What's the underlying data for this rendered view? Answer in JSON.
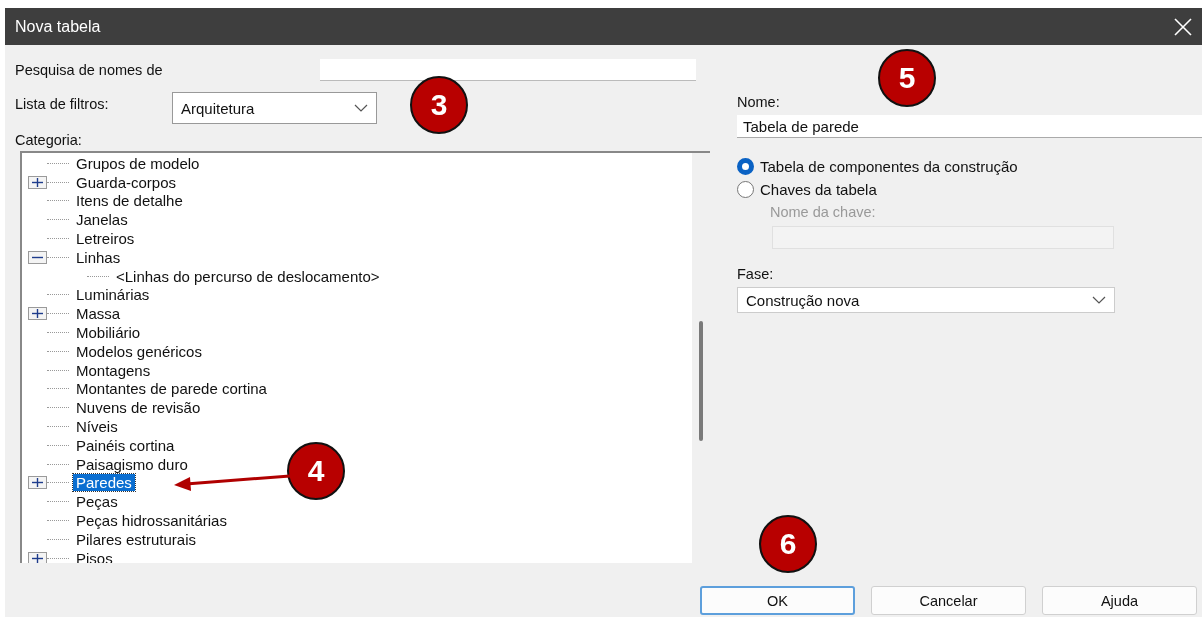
{
  "window": {
    "title": "Nova tabela"
  },
  "search": {
    "label": "Pesquisa de nomes de"
  },
  "filter": {
    "label": "Lista de filtros:",
    "value": "Arquitetura"
  },
  "category": {
    "label": "Categoria:",
    "items": [
      {
        "label": "Grupos de modelo",
        "selected": false
      },
      {
        "label": "Guarda-corpos",
        "selected": false,
        "expanded": false
      },
      {
        "label": "Itens de detalhe",
        "selected": false
      },
      {
        "label": "Janelas",
        "selected": false
      },
      {
        "label": "Letreiros",
        "selected": false
      },
      {
        "label": "Linhas",
        "selected": false,
        "expanded": true,
        "children": [
          {
            "label": "<Linhas do percurso de deslocamento>",
            "selected": false
          }
        ]
      },
      {
        "label": "Luminárias",
        "selected": false
      },
      {
        "label": "Massa",
        "selected": false,
        "expanded": false
      },
      {
        "label": "Mobiliário",
        "selected": false
      },
      {
        "label": "Modelos genéricos",
        "selected": false
      },
      {
        "label": "Montagens",
        "selected": false
      },
      {
        "label": "Montantes de parede cortina",
        "selected": false
      },
      {
        "label": "Nuvens de revisão",
        "selected": false
      },
      {
        "label": "Níveis",
        "selected": false
      },
      {
        "label": "Painéis cortina",
        "selected": false
      },
      {
        "label": "Paisagismo duro",
        "selected": false
      },
      {
        "label": "Paredes",
        "selected": true,
        "expanded": false
      },
      {
        "label": "Peças",
        "selected": false
      },
      {
        "label": "Peças hidrossanitárias",
        "selected": false
      },
      {
        "label": "Pilares estruturais",
        "selected": false
      },
      {
        "label": "Pisos",
        "selected": false,
        "expanded": false
      }
    ]
  },
  "name": {
    "label": "Nome:",
    "value": "Tabela de parede"
  },
  "type_options": [
    {
      "label": "Tabela de componentes da construção",
      "selected": true
    },
    {
      "label": "Chaves da tabela",
      "selected": false
    }
  ],
  "key_name": {
    "label": "Nome da chave:",
    "disabled": true
  },
  "phase": {
    "label": "Fase:",
    "value": "Construção nova"
  },
  "buttons": [
    {
      "label": "OK",
      "default": true
    },
    {
      "label": "Cancelar",
      "default": false
    },
    {
      "label": "Ajuda",
      "default": false
    }
  ],
  "annotations": [
    {
      "label": "3",
      "arrow": false
    },
    {
      "label": "4",
      "arrow": true
    },
    {
      "label": "5",
      "arrow": false
    },
    {
      "label": "6",
      "arrow": false
    }
  ]
}
